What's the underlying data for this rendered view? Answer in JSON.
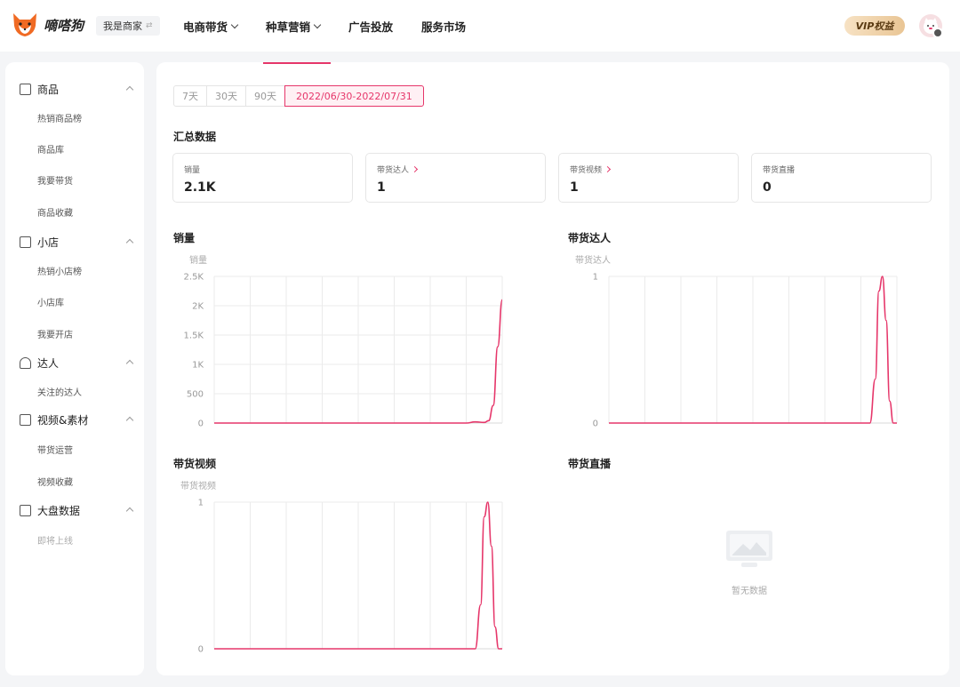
{
  "header": {
    "brand": "嘀嗒狗",
    "role": "我是商家",
    "nav": [
      {
        "label": "电商带货",
        "dropdown": true
      },
      {
        "label": "种草营销",
        "dropdown": true
      },
      {
        "label": "广告投放",
        "dropdown": false
      },
      {
        "label": "服务市场",
        "dropdown": false
      }
    ],
    "vip": "VIP权益"
  },
  "sidebar": {
    "groups": [
      {
        "label": "商品",
        "icon": "cube-icon",
        "items": [
          {
            "label": "热销商品榜"
          },
          {
            "label": "商品库"
          },
          {
            "label": "我要带货"
          },
          {
            "label": "商品收藏"
          }
        ]
      },
      {
        "label": "小店",
        "icon": "store-icon",
        "items": [
          {
            "label": "热销小店榜"
          },
          {
            "label": "小店库"
          },
          {
            "label": "我要开店"
          }
        ]
      },
      {
        "label": "达人",
        "icon": "star-icon",
        "items": [
          {
            "label": "关注的达人"
          }
        ]
      },
      {
        "label": "视频&素材",
        "icon": "video-icon",
        "items": [
          {
            "label": "带货运营"
          },
          {
            "label": "视频收藏"
          }
        ]
      },
      {
        "label": "大盘数据",
        "icon": "dashboard-icon",
        "items": [
          {
            "label": "即将上线"
          }
        ]
      }
    ]
  },
  "date_range": {
    "options": [
      "7天",
      "30天",
      "90天"
    ],
    "selected": "2022/06/30-2022/07/31"
  },
  "summary": {
    "title": "汇总数据",
    "cards": [
      {
        "label": "销量",
        "value": "2.1K",
        "link": false
      },
      {
        "label": "带货达人",
        "value": "1",
        "link": true
      },
      {
        "label": "带货视频",
        "value": "1",
        "link": true
      },
      {
        "label": "带货直播",
        "value": "0",
        "link": false
      }
    ]
  },
  "colors": {
    "accent": "#e6366a",
    "grid": "#ebebeb"
  },
  "chart_data": [
    {
      "type": "line",
      "title": "销量",
      "ylabel": "销量",
      "yticks": [
        "0",
        "500",
        "1K",
        "1.5K",
        "2K",
        "2.5K"
      ],
      "ylim": [
        0,
        2500
      ],
      "xlim": [
        0,
        32
      ],
      "x": [
        0,
        4,
        8,
        12,
        16,
        20,
        24,
        28,
        29,
        30,
        30.5,
        31,
        31.5,
        32
      ],
      "y": [
        0,
        0,
        0,
        0,
        0,
        0,
        0,
        0,
        20,
        10,
        40,
        300,
        1300,
        2100
      ]
    },
    {
      "type": "line",
      "title": "带货达人",
      "ylabel": "带货达人",
      "yticks": [
        "0",
        "1"
      ],
      "ylim": [
        0,
        1
      ],
      "xlim": [
        0,
        32
      ],
      "x": [
        0,
        4,
        8,
        12,
        16,
        20,
        24,
        28,
        29,
        29.6,
        30,
        30.4,
        30.8,
        31.2,
        31.6,
        32
      ],
      "y": [
        0,
        0,
        0,
        0,
        0,
        0,
        0,
        0,
        0,
        0.3,
        0.9,
        1,
        0.7,
        0.15,
        0,
        0
      ]
    },
    {
      "type": "line",
      "title": "带货视频",
      "ylabel": "带货视频",
      "yticks": [
        "0",
        "1"
      ],
      "ylim": [
        0,
        1
      ],
      "xlim": [
        0,
        32
      ],
      "x": [
        0,
        4,
        8,
        12,
        16,
        20,
        24,
        28,
        29,
        29.6,
        30,
        30.4,
        30.8,
        31.2,
        31.6,
        32
      ],
      "y": [
        0,
        0,
        0,
        0,
        0,
        0,
        0,
        0,
        0,
        0.3,
        0.9,
        1,
        0.7,
        0.15,
        0,
        0
      ]
    }
  ],
  "live": {
    "title": "带货直播",
    "empty_text": "暂无数据"
  }
}
